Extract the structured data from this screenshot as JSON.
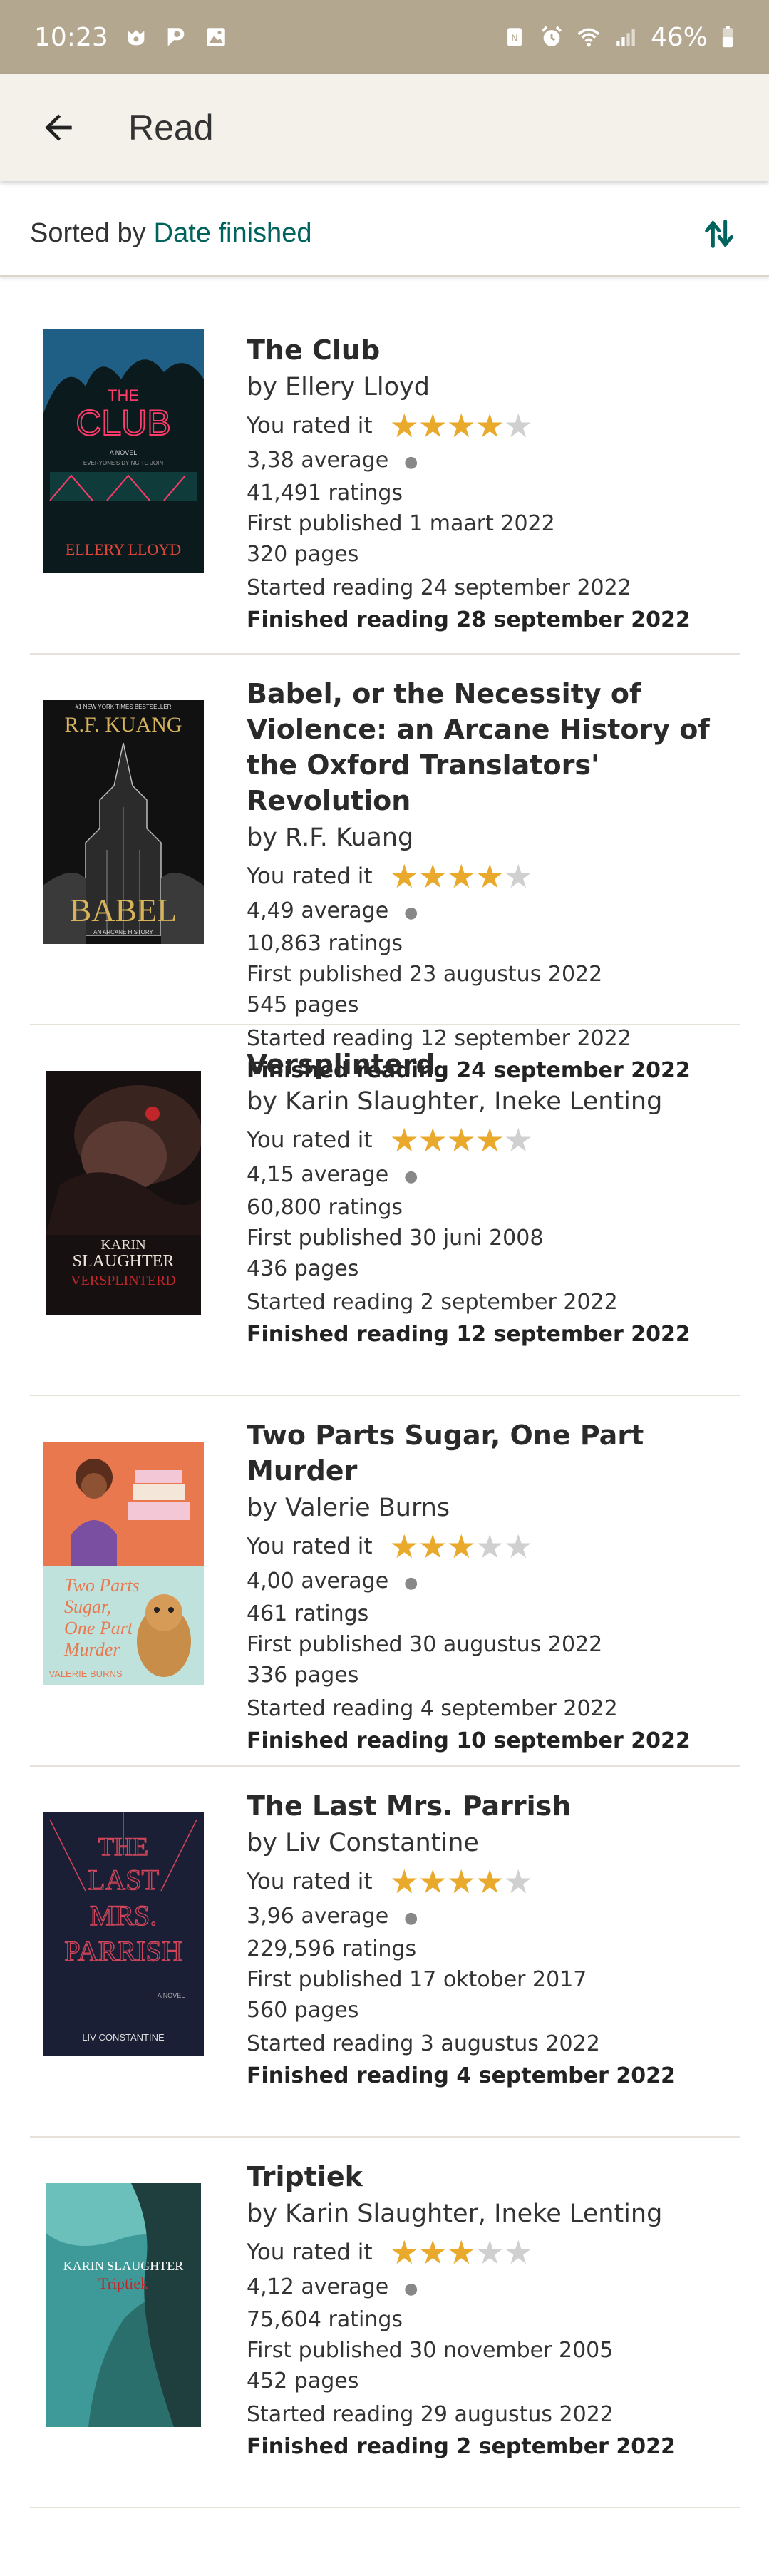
{
  "status_bar": {
    "time": "10:23",
    "battery": "46%"
  },
  "app_bar": {
    "title": "Read",
    "back_icon": "arrow-left-icon"
  },
  "sort_bar": {
    "prefix": "Sorted by",
    "value": "Date finished",
    "toggle_icon": "sort-arrows-icon"
  },
  "colors": {
    "accent": "#00635d",
    "star": "#e9a92c",
    "status_bar": "#b4a78f",
    "app_bar": "#f4f1ea"
  },
  "books": [
    {
      "title": "The Club",
      "author": "by Ellery Lloyd",
      "rated_label": "You rated it",
      "rating": 4,
      "average": "3,38 average",
      "ratings": "41,491 ratings",
      "published": "First published 1 maart 2022",
      "pages": "320 pages",
      "started": "Started reading 24 september 2022",
      "finished": "Finished reading 28 september 2022",
      "cover": {
        "line1": "THE",
        "line2": "CLUB",
        "tag": "A NOVEL",
        "tagline": "EVERYONE'S DYING TO JOIN",
        "author": "ELLERY LLOYD",
        "bg": "#0d1b1e",
        "accent": "#ff3b6b"
      }
    },
    {
      "title": "Babel, or the Necessity of Violence: an Arcane History of the Oxford Translators' Revolution",
      "author": "by R.F. Kuang",
      "rated_label": "You rated it",
      "rating": 4,
      "average": "4,49 average",
      "ratings": "10,863 ratings",
      "published": "First published 23 augustus 2022",
      "pages": "545 pages",
      "started": "Started reading 12 september 2022",
      "finished": "Finished reading 24 september 2022",
      "cover": {
        "top": "#1 NEW YORK TIMES BESTSELLER",
        "author": "R.F. KUANG",
        "title": "BABEL",
        "sub": "AN ARCANE HISTORY",
        "bg": "#111111",
        "accent": "#d7b35a"
      }
    },
    {
      "title": "Versplinterd",
      "author": "by Karin Slaughter, Ineke Lenting",
      "rated_label": "You rated it",
      "rating": 4,
      "average": "4,15 average",
      "ratings": "60,800 ratings",
      "published": "First published 30 juni 2008",
      "pages": "436 pages",
      "started": "Started reading 2 september 2022",
      "finished": "Finished reading 12 september 2022",
      "cover": {
        "author1": "KARIN",
        "author2": "SLAUGHTER",
        "title": "VERSPLINTERD",
        "bg": "#1a1212",
        "accent": "#c0262a"
      }
    },
    {
      "title": "Two Parts Sugar, One Part Murder",
      "author": "by Valerie Burns",
      "rated_label": "You rated it",
      "rating": 3,
      "average": "4,00 average",
      "ratings": "461 ratings",
      "published": "First published 30 augustus 2022",
      "pages": "336 pages",
      "started": "Started reading 4 september 2022",
      "finished": "Finished reading 10 september 2022",
      "cover": {
        "title": "Two Parts Sugar, One Part Murder",
        "author": "VALERIE BURNS",
        "bg": "#e9784f",
        "accent": "#f2d9c4"
      }
    },
    {
      "title": "The Last Mrs. Parrish",
      "author": "by Liv Constantine",
      "rated_label": "You rated it",
      "rating": 4,
      "average": "3,96 average",
      "ratings": "229,596 ratings",
      "published": "First published 17 oktober 2017",
      "pages": "560 pages",
      "started": "Started reading 3 augustus 2022",
      "finished": "Finished reading 4 september 2022",
      "cover": {
        "l1": "THE",
        "l2": "LAST",
        "l3": "MRS.",
        "l4": "PARRISH",
        "tag": "A NOVEL",
        "author": "LIV CONSTANTINE",
        "bg": "#1b1f35",
        "accent": "#d1455a"
      }
    },
    {
      "title": "Triptiek",
      "author": "by Karin Slaughter, Ineke Lenting",
      "rated_label": "You rated it",
      "rating": 3,
      "average": "4,12 average",
      "ratings": "75,604 ratings",
      "published": "First published 30 november 2005",
      "pages": "452 pages",
      "started": "Started reading 29 augustus 2022",
      "finished": "Finished reading 2 september 2022",
      "cover": {
        "author": "KARIN SLAUGHTER",
        "title": "Triptiek",
        "bg": "#3e9a98",
        "accent": "#c0262a"
      }
    }
  ]
}
